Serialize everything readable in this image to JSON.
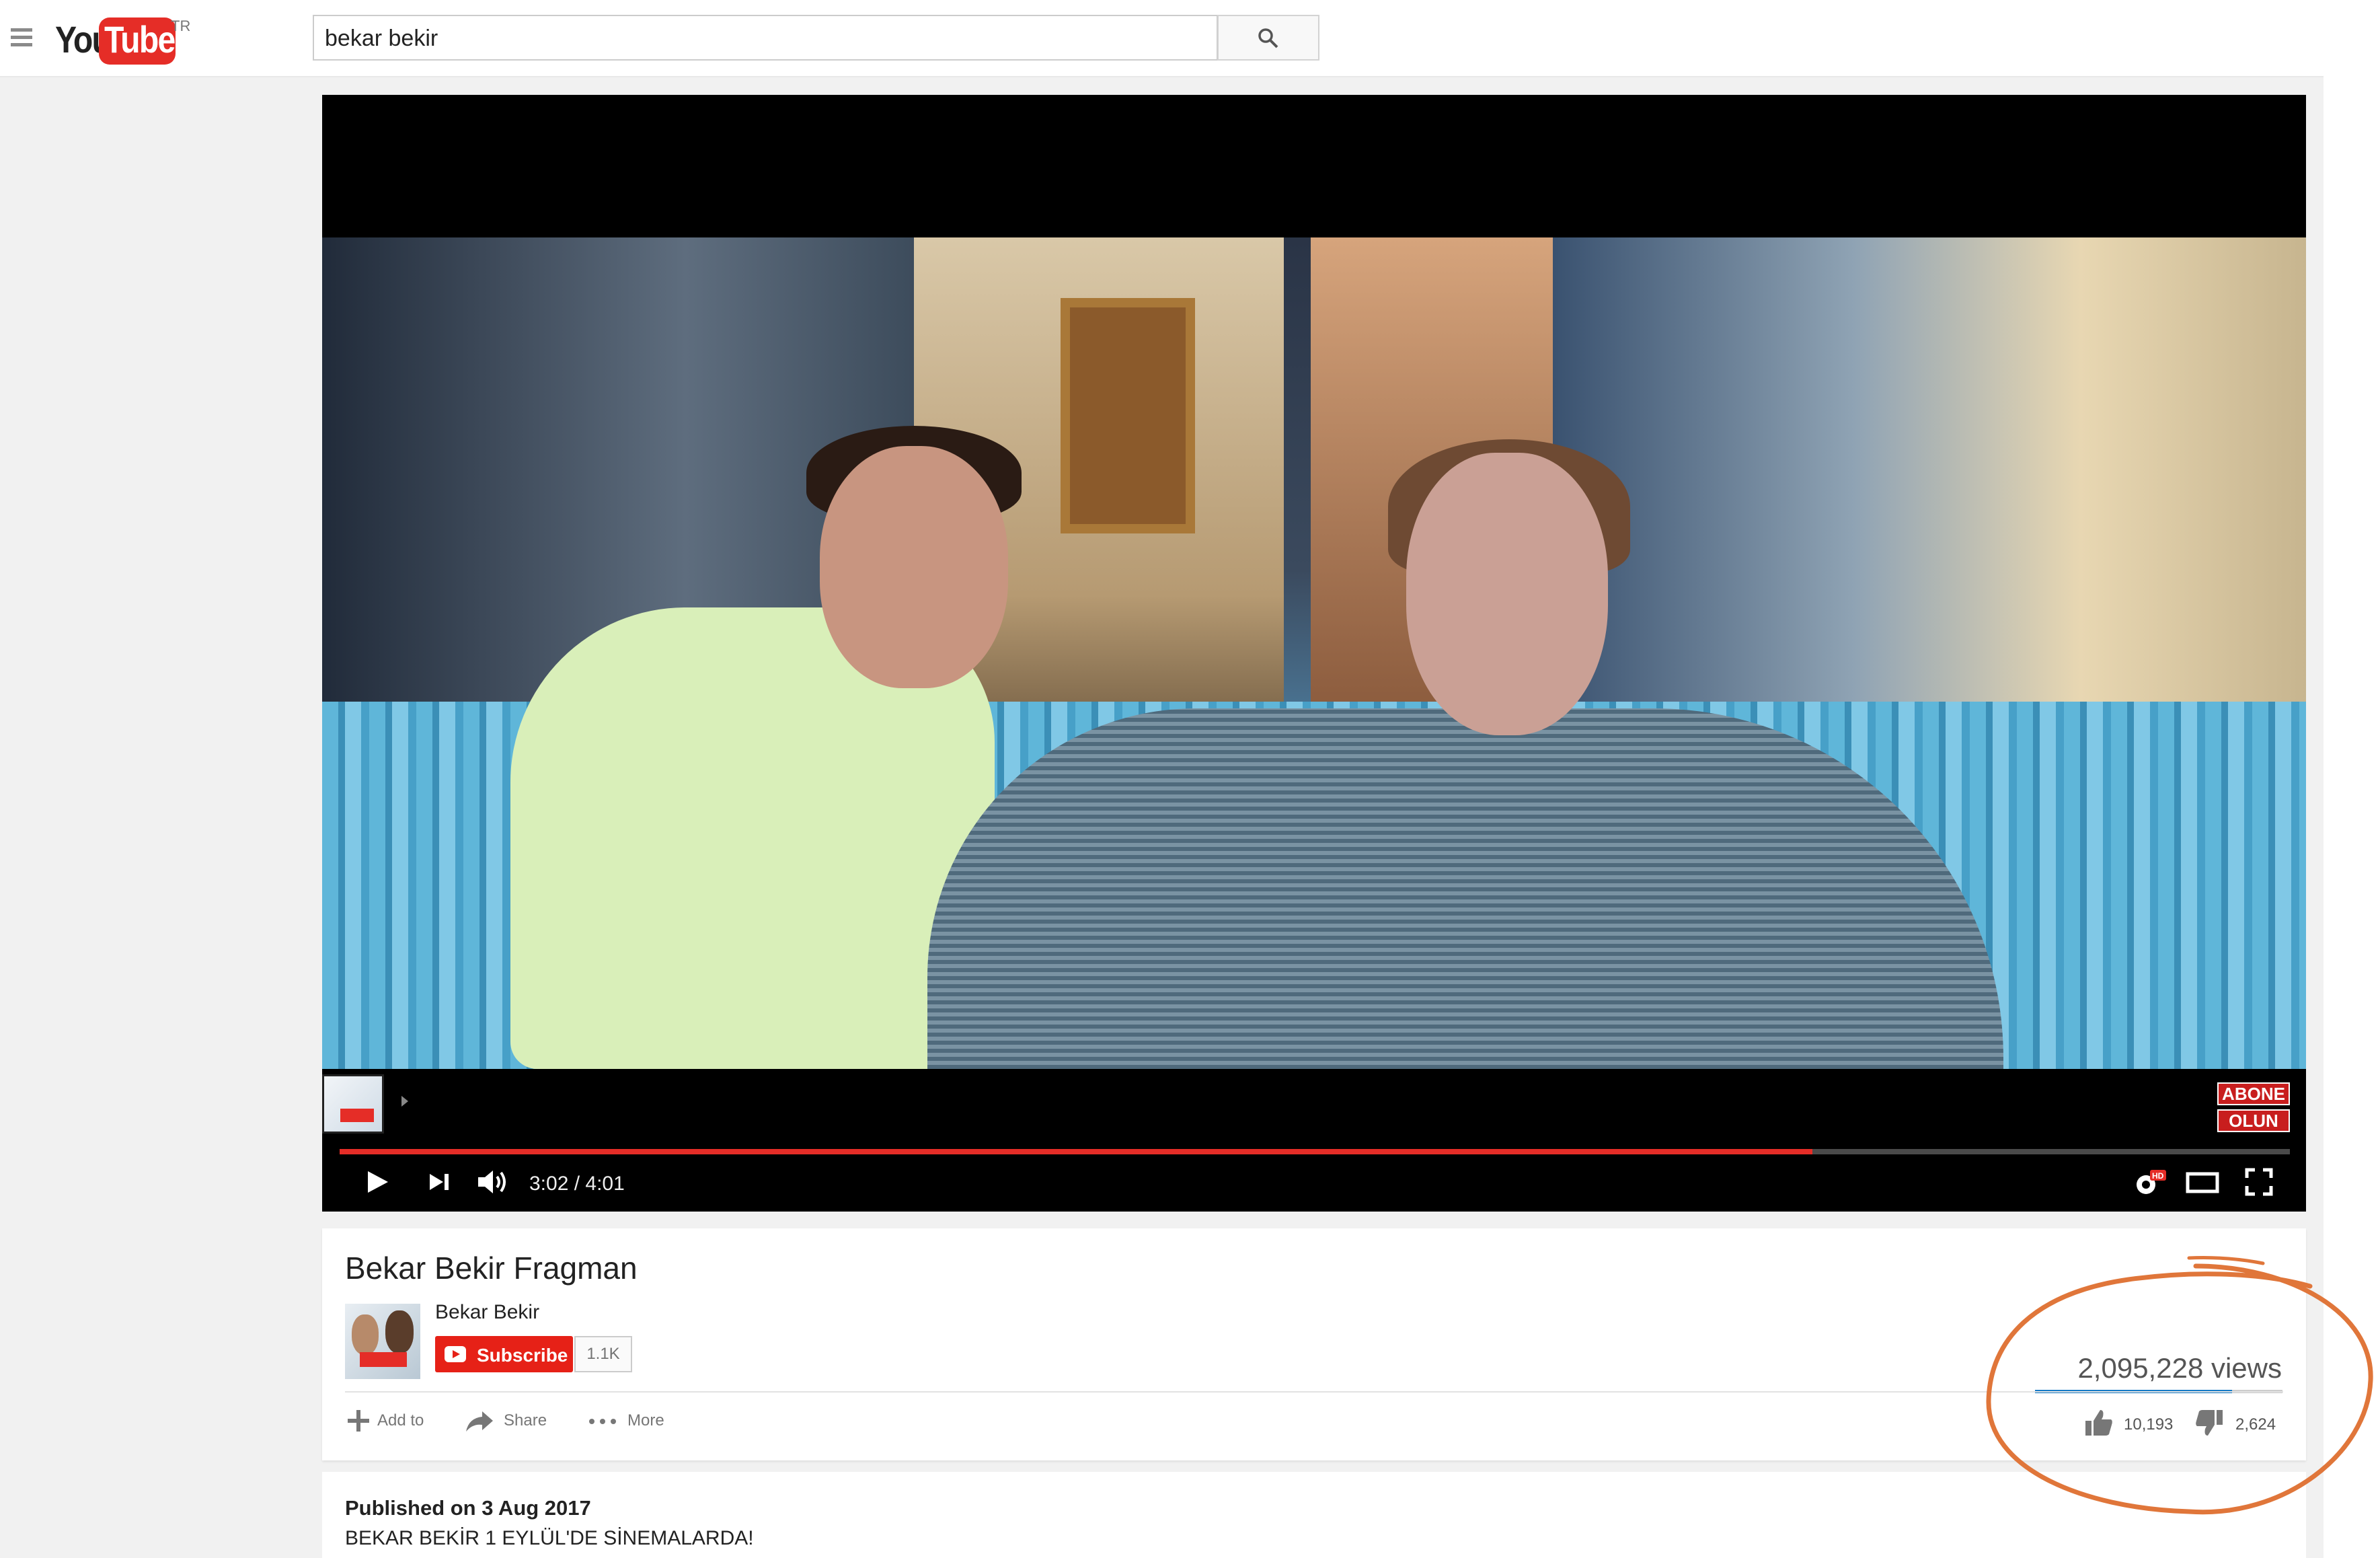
{
  "masthead": {
    "logo_you": "You",
    "logo_tube": "Tube",
    "country_code": "TR",
    "search_value": "bekar bekir"
  },
  "player": {
    "time": "3:02 / 4:01",
    "progress_fraction": 0.755,
    "endscreen_button_line1": "ABONE",
    "endscreen_button_line2": "OLUN"
  },
  "video": {
    "title": "Bekar Bekir Fragman",
    "channel_name": "Bekar Bekir",
    "subscribe_label": "Subscribe",
    "subscriber_count": "1.1K",
    "views": "2,095,228 views",
    "likes": "10,193",
    "dislikes": "2,624",
    "like_fraction": 0.795
  },
  "actions": {
    "add_to": "Add to",
    "share": "Share",
    "more": "More"
  },
  "description": {
    "published": "Published on 3 Aug 2017",
    "text": "BEKAR BEKİR 1 EYLÜL'DE SİNEMALARDA!"
  },
  "colors": {
    "brand_red": "#e52d27",
    "like_bar": "#167ac6",
    "highlight_circle": "#e0763a"
  }
}
